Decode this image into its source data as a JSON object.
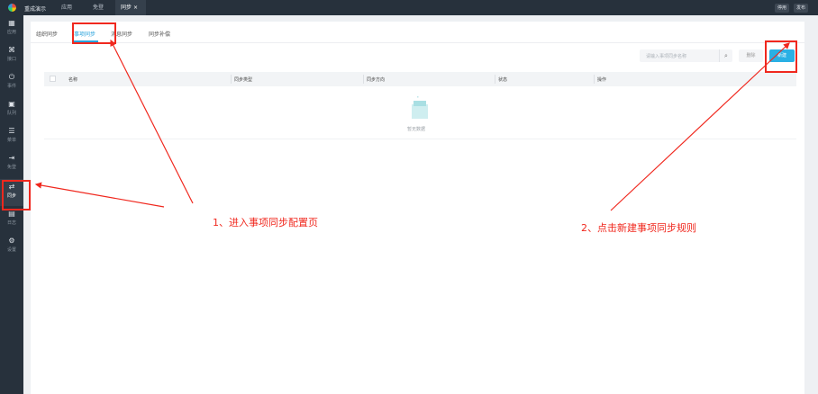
{
  "topbar": {
    "app_name": "重成演示",
    "tabs": [
      "应用",
      "免登",
      "同步"
    ],
    "close": "×",
    "buttons": {
      "disable": "停用",
      "publish": "发布"
    }
  },
  "sidebar": {
    "items": [
      {
        "icon": "grid-icon",
        "glyph": "▦",
        "label": "应用"
      },
      {
        "icon": "api-icon",
        "glyph": "⌘",
        "label": "接口"
      },
      {
        "icon": "event-icon",
        "glyph": "⏻",
        "label": "事件"
      },
      {
        "icon": "queue-icon",
        "glyph": "▣",
        "label": "队列"
      },
      {
        "icon": "menu-icon",
        "glyph": "☰",
        "label": "菜单"
      },
      {
        "icon": "login-icon",
        "glyph": "⇥",
        "label": "免登"
      },
      {
        "icon": "sync-icon",
        "glyph": "⇄",
        "label": "同步"
      },
      {
        "icon": "log-icon",
        "glyph": "▤",
        "label": "日志"
      },
      {
        "icon": "settings-icon",
        "glyph": "⚙",
        "label": "设置"
      }
    ],
    "active": 6
  },
  "main": {
    "tabs": [
      "组织同步",
      "事项同步",
      "消息同步",
      "同步补偿"
    ],
    "active_tab": 1,
    "search": {
      "placeholder": "请输入事项同步名称"
    },
    "delete_label": "删除",
    "new_label": "新建",
    "columns": [
      "名称",
      "同步类型",
      "同步方向",
      "状态",
      "操作"
    ],
    "empty_text": "暂无数据"
  },
  "annotations": {
    "step1": "1、进入事项同步配置页",
    "step2": "2、点击新建事项同步规则",
    "color": "#f0281e"
  },
  "colors": {
    "accent": "#2ab0e4",
    "sidebar": "#27313c"
  }
}
